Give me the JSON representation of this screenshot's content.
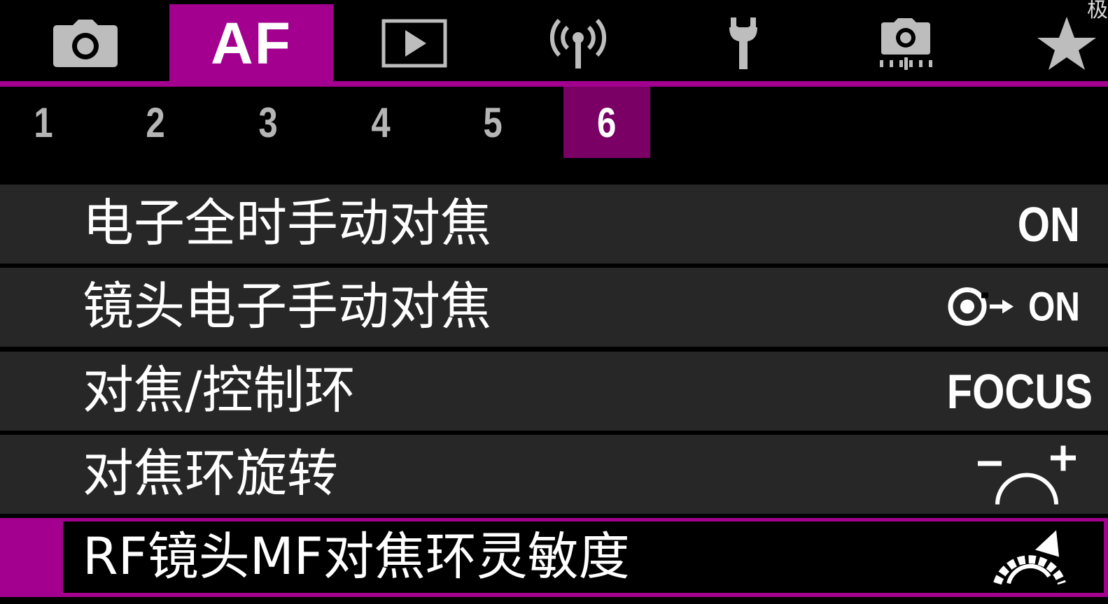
{
  "main_tabs": [
    {
      "id": "shooting",
      "icon": "camera-icon",
      "active": false
    },
    {
      "id": "af",
      "label": "AF",
      "active": true
    },
    {
      "id": "playback",
      "icon": "playback-icon",
      "active": false
    },
    {
      "id": "wireless",
      "icon": "wireless-antenna-icon",
      "active": false
    },
    {
      "id": "setup",
      "icon": "wrench-icon",
      "active": false
    },
    {
      "id": "custom",
      "icon": "custom-functions-camera-icon",
      "active": false
    },
    {
      "id": "my-menu",
      "icon": "star-icon",
      "active": false
    }
  ],
  "corner_text": "极",
  "page_tabs": [
    "1",
    "2",
    "3",
    "4",
    "5",
    "6"
  ],
  "active_page": "6",
  "menu_items": [
    {
      "label": "电子全时手动对焦",
      "value": "ON"
    },
    {
      "label": "镜头电子手动对焦",
      "value": "ON",
      "value_icon": "focus-ring-arrow-icon"
    },
    {
      "label": "对焦/控制环",
      "value": "FOCUS"
    },
    {
      "label": "对焦环旋转",
      "value_icon": "minus-arc-plus-icon"
    },
    {
      "label": "RF镜头MF对焦环灵敏度",
      "value_icon": "ring-sensitivity-arc-icon",
      "selected": true
    }
  ],
  "colors": {
    "accent": "#a3008f",
    "page_tab_active": "#7a0066",
    "row_bg": "#272727",
    "background": "#000000"
  }
}
